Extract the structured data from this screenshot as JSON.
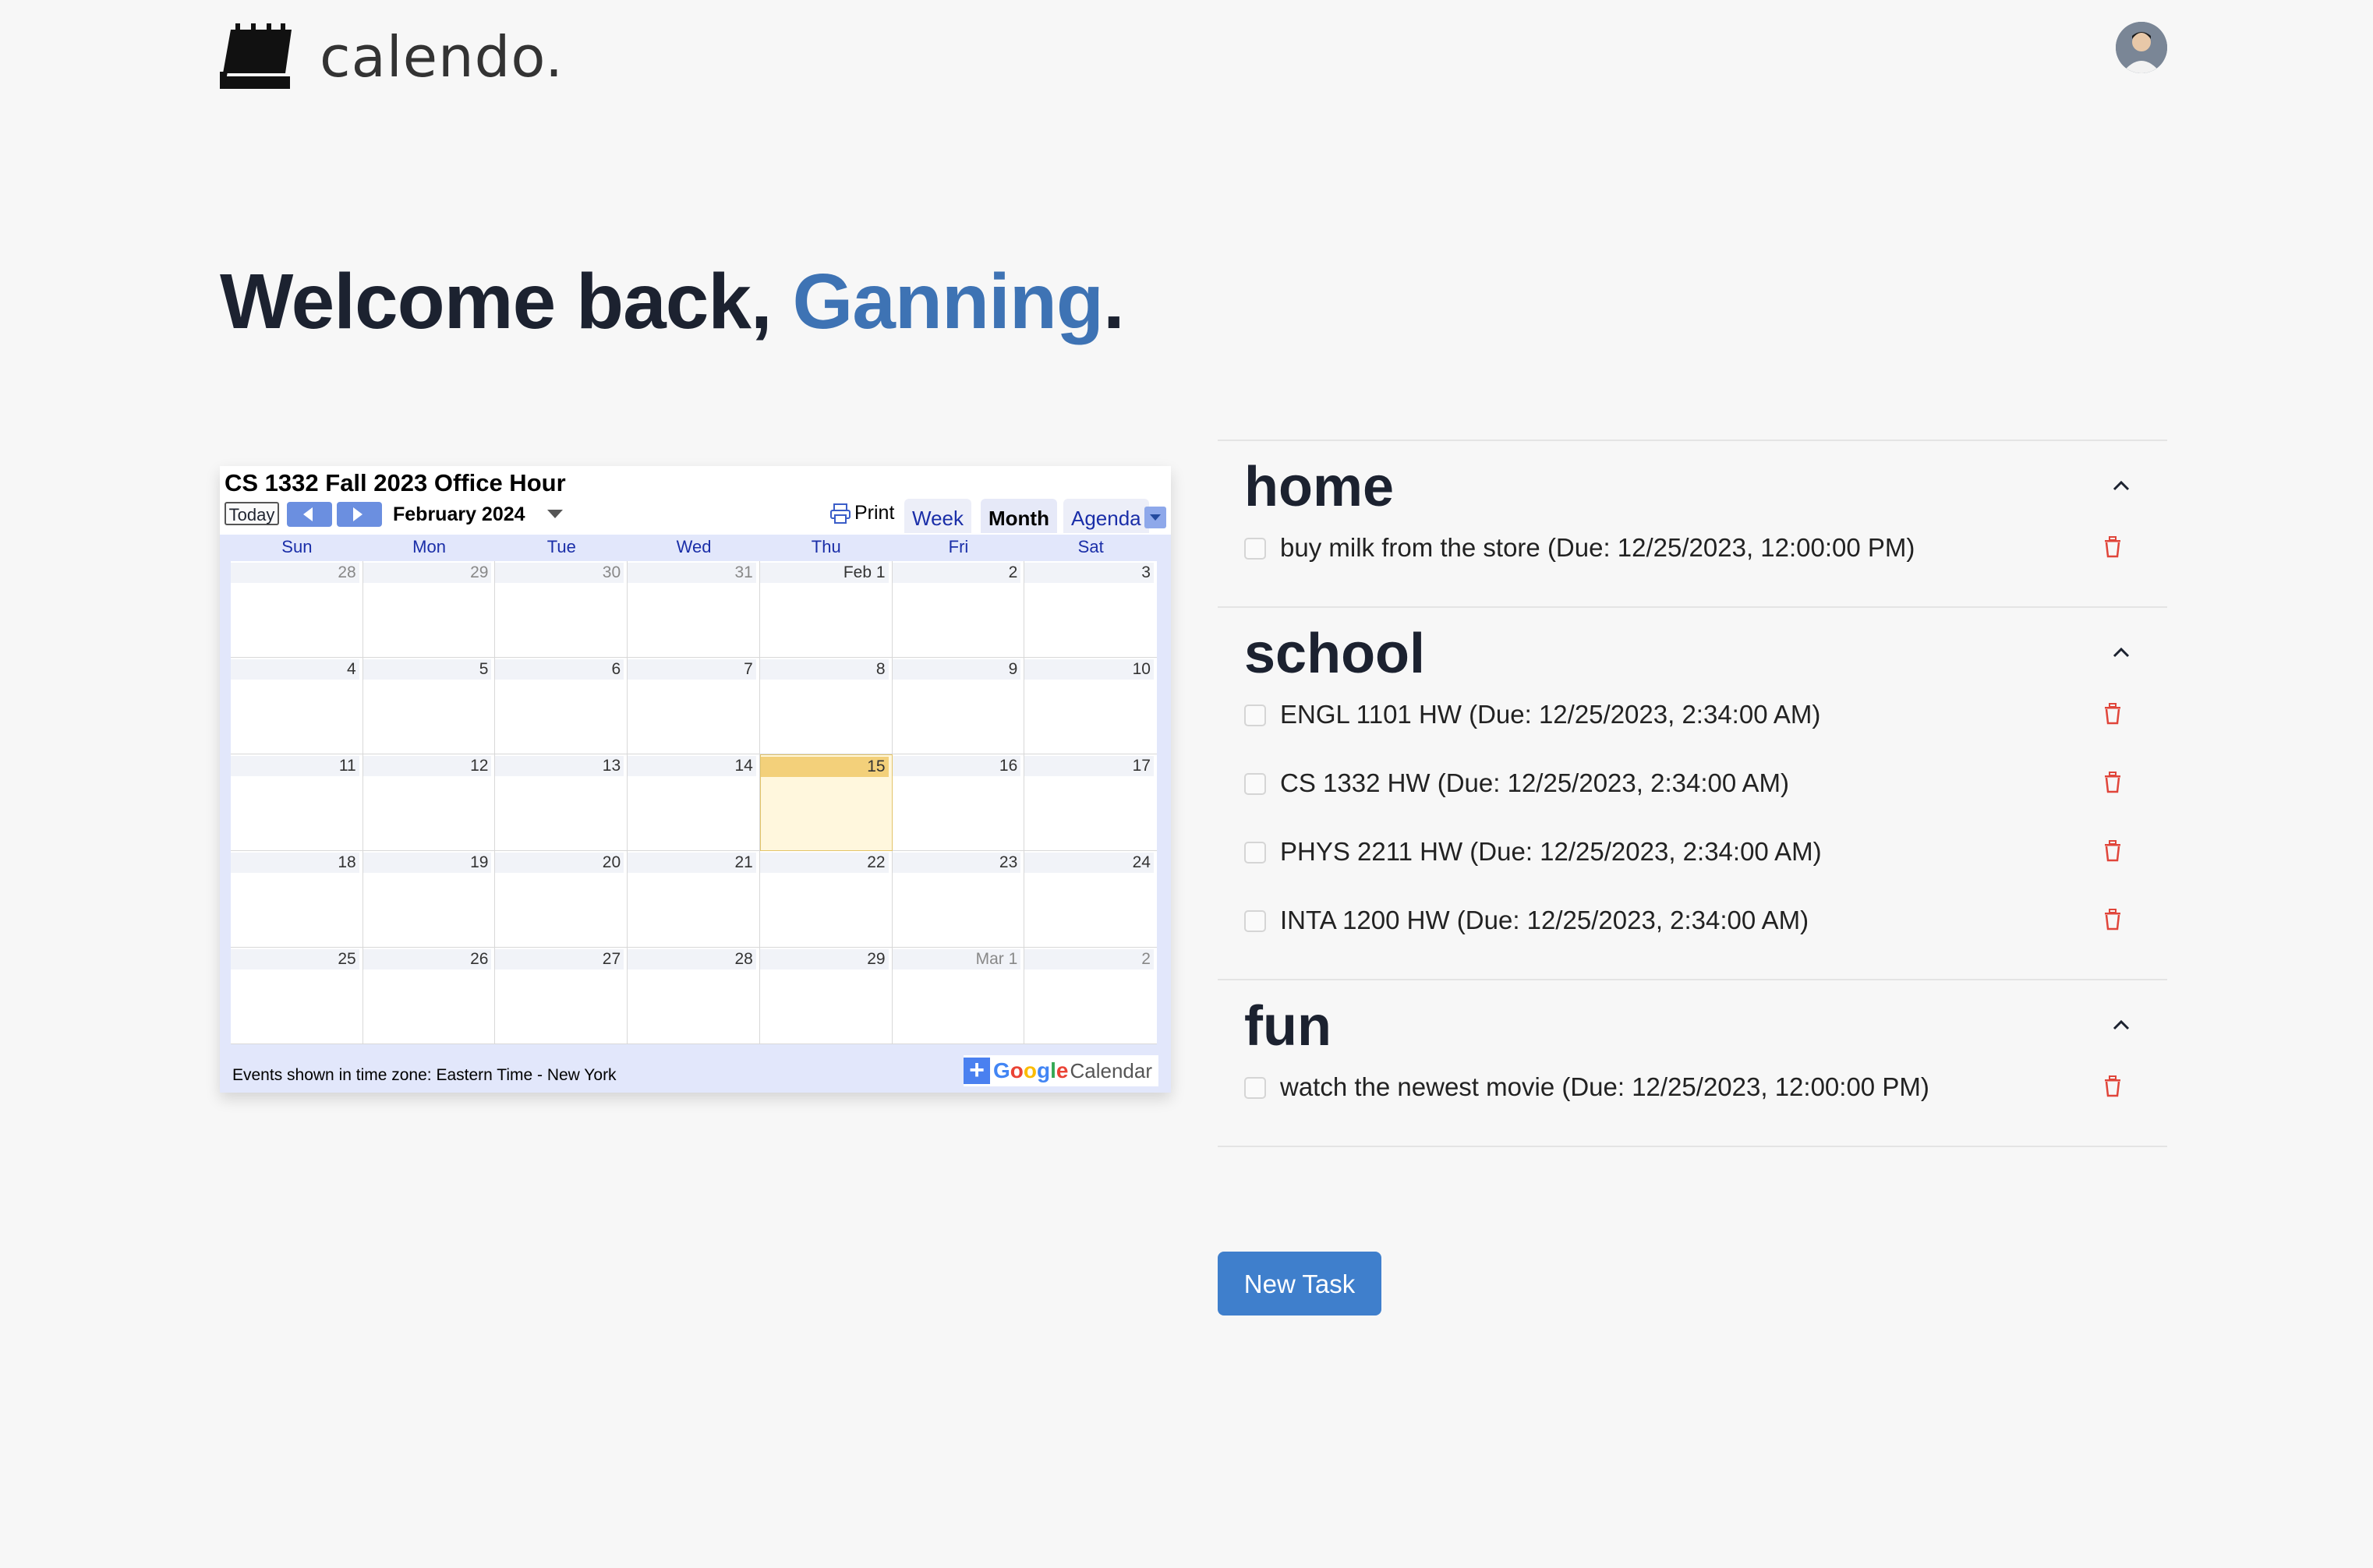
{
  "app": {
    "name": "calendo.",
    "avatar_icon": "user-avatar"
  },
  "welcome": {
    "prefix": "Welcome back, ",
    "name": "Ganning",
    "suffix": "."
  },
  "calendar": {
    "title": "CS 1332 Fall 2023 Office Hour",
    "today_label": "Today",
    "month_label": "February 2024",
    "print_label": "Print",
    "tabs": [
      "Week",
      "Month",
      "Agenda"
    ],
    "active_tab": "Month",
    "days_of_week": [
      "Sun",
      "Mon",
      "Tue",
      "Wed",
      "Thu",
      "Fri",
      "Sat"
    ],
    "weeks": [
      [
        "28",
        "29",
        "30",
        "31",
        "Feb 1",
        "2",
        "3"
      ],
      [
        "4",
        "5",
        "6",
        "7",
        "8",
        "9",
        "10"
      ],
      [
        "11",
        "12",
        "13",
        "14",
        "15",
        "16",
        "17"
      ],
      [
        "18",
        "19",
        "20",
        "21",
        "22",
        "23",
        "24"
      ],
      [
        "25",
        "26",
        "27",
        "28",
        "29",
        "Mar 1",
        "2"
      ]
    ],
    "today_date": "15",
    "timezone_note": "Events shown in time zone: Eastern Time - New York",
    "badge_google": "Google",
    "badge_calendar": "Calendar"
  },
  "task_sections": [
    {
      "title": "home",
      "tasks": [
        "buy milk from the store (Due: 12/25/2023, 12:00:00 PM)"
      ]
    },
    {
      "title": "school",
      "tasks": [
        "ENGL 1101 HW (Due: 12/25/2023, 2:34:00 AM)",
        "CS 1332 HW (Due: 12/25/2023, 2:34:00 AM)",
        "PHYS 2211 HW (Due: 12/25/2023, 2:34:00 AM)",
        "INTA 1200 HW (Due: 12/25/2023, 2:34:00 AM)"
      ]
    },
    {
      "title": "fun",
      "tasks": [
        "watch the newest movie (Due: 12/25/2023, 12:00:00 PM)"
      ]
    }
  ],
  "new_task_label": "New Task",
  "colors": {
    "accent": "#3f7fcc",
    "name_highlight": "#3e73b4",
    "delete": "#e0453a",
    "today_cell": "#fff7dd"
  }
}
